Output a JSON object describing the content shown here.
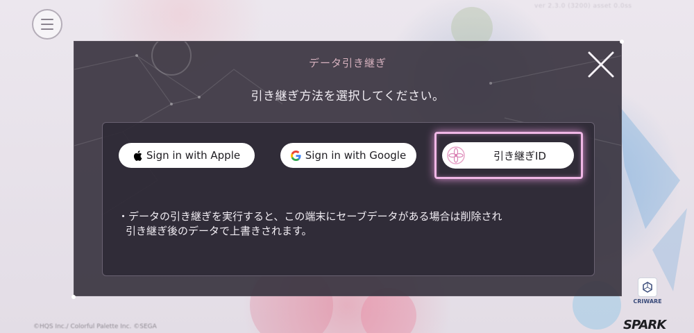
{
  "header": {
    "menu_icon": "hamburger-menu-icon",
    "version_text": "ver 2.3.0 (3200) asset 0.0ss"
  },
  "modal": {
    "title": "データ引き継ぎ",
    "subtitle": "引き継ぎ方法を選択してください。",
    "close_icon": "close-x-icon",
    "buttons": {
      "apple": {
        "label": "Sign in with Apple",
        "icon": "apple-logo-icon"
      },
      "google": {
        "label": "Sign in with Google",
        "icon": "google-g-logo-icon"
      },
      "transfer_id": {
        "label": "引き継ぎID",
        "icon": "pink-flower-emblem-icon",
        "highlight_color": "#f0b7e6"
      }
    },
    "notice_line1": "・データの引き継ぎを実行すると、この端末にセーブデータがある場合は削除され",
    "notice_line2": "引き継ぎ後のデータで上書きされます。"
  },
  "footer": {
    "copyright": "©HQS Inc./ Colorful Palette Inc. ©SEGA",
    "criware_label": "CRIWARE",
    "spark_logo": "SPARK"
  },
  "colors": {
    "modal_bg": "#3a3440",
    "title_pink": "#d7b2bf",
    "highlight_pink": "#f0b7e6"
  }
}
